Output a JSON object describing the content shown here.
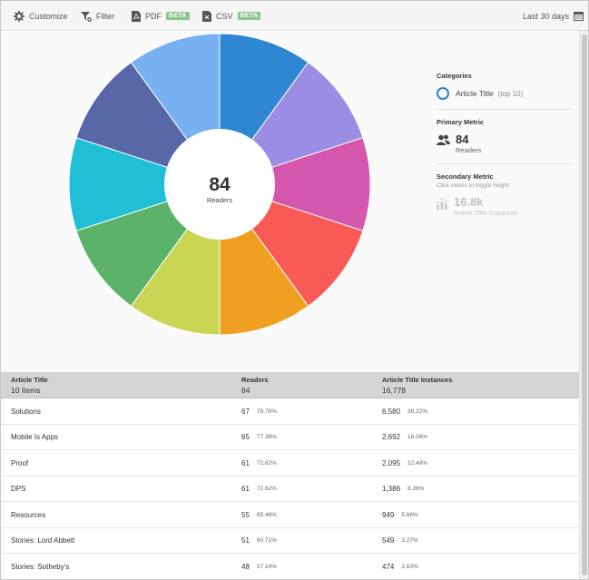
{
  "toolbar": {
    "customize_label": "Customize",
    "filter_label": "Filter",
    "pdf_label": "PDF",
    "pdf_badge": "BETA",
    "csv_label": "CSV",
    "csv_badge": "BETA",
    "date_range_label": "Last 30 days"
  },
  "donut": {
    "center_value": "84",
    "center_label": "Readers",
    "slice_colors": [
      "#2f86d3",
      "#9b8de3",
      "#d557ad",
      "#fa5a55",
      "#f0a020",
      "#c8d653",
      "#5cb268",
      "#20bfd6",
      "#5767a8",
      "#77b1f2"
    ]
  },
  "side_panel": {
    "categories_heading": "Categories",
    "category_name": "Article Title",
    "category_note": "(top 10)",
    "primary_heading": "Primary Metric",
    "primary_value": "84",
    "primary_label": "Readers",
    "secondary_heading": "Secondary Metric",
    "secondary_hint": "Click metric to toggle height",
    "secondary_value": "16.8k",
    "secondary_label": "Article Title Instances"
  },
  "table": {
    "headers": [
      {
        "title": "Article Title",
        "sub": "10 Items"
      },
      {
        "title": "Readers",
        "sub": "84"
      },
      {
        "title": "Article Title Instances",
        "sub": "16,778"
      }
    ],
    "rows": [
      {
        "title": "Solutions",
        "readers": "67",
        "readers_pct": "79.76%",
        "instances": "6,580",
        "instances_pct": "39.22%"
      },
      {
        "title": "Mobile Is Apps",
        "readers": "65",
        "readers_pct": "77.38%",
        "instances": "2,692",
        "instances_pct": "16.04%"
      },
      {
        "title": "Proof",
        "readers": "61",
        "readers_pct": "72.62%",
        "instances": "2,095",
        "instances_pct": "12.49%"
      },
      {
        "title": "DPS",
        "readers": "61",
        "readers_pct": "72.62%",
        "instances": "1,386",
        "instances_pct": "8.26%"
      },
      {
        "title": "Resources",
        "readers": "55",
        "readers_pct": "65.48%",
        "instances": "949",
        "instances_pct": "5.66%"
      },
      {
        "title": "Stories: Lord Abbett",
        "readers": "51",
        "readers_pct": "60.71%",
        "instances": "549",
        "instances_pct": "3.27%"
      },
      {
        "title": "Stories: Sotheby's",
        "readers": "48",
        "readers_pct": "57.14%",
        "instances": "474",
        "instances_pct": "2.83%"
      }
    ]
  }
}
